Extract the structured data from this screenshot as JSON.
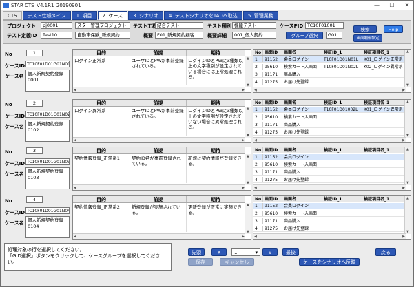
{
  "window": {
    "title": "STAR CTS_V4.1R1_20190901",
    "minimize": "—",
    "maximize": "☐",
    "close": "✕"
  },
  "tabs": [
    "CTS",
    "テスト仕様メイン",
    "1. 項目",
    "2. ケース",
    "3. シナリオ",
    "4. テストシナリオをTADへ取込",
    "5. 管理業務"
  ],
  "header": {
    "project_label": "プロジェクト",
    "project_code": "pj0001",
    "project_name": "スター管理プロジェクト",
    "test_def_label": "テスト定義ID",
    "test_def_id": "Test10",
    "test_def_name": "自動車保険_新規契約",
    "process_label": "テスト工程",
    "process_value": "結合テスト",
    "outline_label": "概要",
    "outline_value": "F01_新規契約顧客",
    "type_label": "テスト種別",
    "type_value": "機能テスト",
    "detail_label": "概要詳細",
    "detail_value": "001_個人契約",
    "casepid_label": "ケースPID",
    "casepid_value": "TC10F01001",
    "group_btn": "グループ選択",
    "group_value": "G01",
    "search_btn": "検索",
    "help_btn": "Help",
    "screen_setting_btn": "画面制御設定"
  },
  "labels": {
    "no": "No",
    "case_id": "ケースID",
    "case_name": "ケース名",
    "purpose": "目的",
    "premise": "前提",
    "expect": "期待",
    "s_no": "No",
    "s_screen": "画面ID",
    "s_screen_name": "画面名",
    "s_verify": "検証ID_1",
    "s_verify_name": "検証項目名_1"
  },
  "cases": [
    {
      "no": "1",
      "id": "TC10F01D01G01N01",
      "name": "個人新規契約登録\n0001",
      "purpose": "ログイン正常系",
      "premise": "ユーザIDとPWが事前登録されている。",
      "expect": "ログインIDとPWに3種類以上の文字種別が設定されている場合には正常処理される。",
      "screens": [
        {
          "no": "1",
          "sid": "91152",
          "sname": "会員ログイン",
          "vid": "T10F01D01N01L",
          "vname": "K01_ログイン正常系"
        },
        {
          "no": "2",
          "sid": "95610",
          "sname": "検索カート入画面",
          "vid": "T10F01D01N02L",
          "vname": "K02_ログイン異常系"
        },
        {
          "no": "3",
          "sid": "91171",
          "sname": "商品購入",
          "vid": "",
          "vname": ""
        },
        {
          "no": "4",
          "sid": "91275",
          "sname": "お届け先登録",
          "vid": "",
          "vname": ""
        }
      ]
    },
    {
      "no": "2",
      "id": "TC10F01D01G01N02",
      "name": "個人新規契約登録\n0102",
      "purpose": "ログイン異常系",
      "premise": "ユーザIDとPWが事前登録されている。",
      "expect": "ログインIDとPWに3種類以上の文字種別が設定されていない場合に異常処理される。",
      "screens": [
        {
          "no": "1",
          "sid": "91152",
          "sname": "会員ログイン",
          "vid": "T10F01D01002L",
          "vname": "K01_ログイン異常系"
        },
        {
          "no": "2",
          "sid": "95610",
          "sname": "検索カート入画面",
          "vid": "",
          "vname": ""
        },
        {
          "no": "3",
          "sid": "91171",
          "sname": "商品購入",
          "vid": "",
          "vname": ""
        },
        {
          "no": "4",
          "sid": "91275",
          "sname": "お届け先登録",
          "vid": "",
          "vname": ""
        }
      ]
    },
    {
      "no": "3",
      "id": "TC10F01D01G01N03",
      "name": "個人新規契約登録\n0103",
      "purpose": "契約情報登録_正常系1",
      "premise": "契約ID名が事前登録されている。",
      "expect": "新規に契約情報が登録できる。",
      "screens": [
        {
          "no": "1",
          "sid": "91152",
          "sname": "会員ログイン",
          "vid": "",
          "vname": ""
        },
        {
          "no": "2",
          "sid": "95610",
          "sname": "検索カート入画面",
          "vid": "",
          "vname": ""
        },
        {
          "no": "3",
          "sid": "91171",
          "sname": "商品購入",
          "vid": "",
          "vname": ""
        },
        {
          "no": "4",
          "sid": "91275",
          "sname": "お届け先登録",
          "vid": "",
          "vname": ""
        }
      ]
    },
    {
      "no": "4",
      "id": "TC10F01D01G01N04",
      "name": "個人新規契約登録\n0104",
      "purpose": "契約情報登録_正常系2",
      "premise": "新規登録が実施されている。",
      "expect": "更新登録が正常に実施できる。",
      "screens": [
        {
          "no": "1",
          "sid": "91152",
          "sname": "会員ログイン",
          "vid": "",
          "vname": ""
        },
        {
          "no": "2",
          "sid": "95610",
          "sname": "検索カート入画面",
          "vid": "",
          "vname": ""
        },
        {
          "no": "3",
          "sid": "91171",
          "sname": "商品購入",
          "vid": "",
          "vname": ""
        },
        {
          "no": "4",
          "sid": "91275",
          "sname": "お届け先登録",
          "vid": "",
          "vname": ""
        }
      ]
    }
  ],
  "footer": {
    "message_line1": "処理対象の行を選択してください。",
    "message_line2": "「GID選択」ボタンをクリックして、ケースグループを選択してください。",
    "first_btn": "先頭",
    "prev_btn": "∧",
    "page_value": "1",
    "next_btn": "∨",
    "last_btn": "最後",
    "save_btn": "保存",
    "cancel_btn": "キャンセル",
    "apply_btn": "ケースをシナリオへ反映",
    "back_btn": "戻る"
  },
  "colors": {
    "accent": "#2c57b5",
    "selected_row": "#d7e6fb"
  }
}
